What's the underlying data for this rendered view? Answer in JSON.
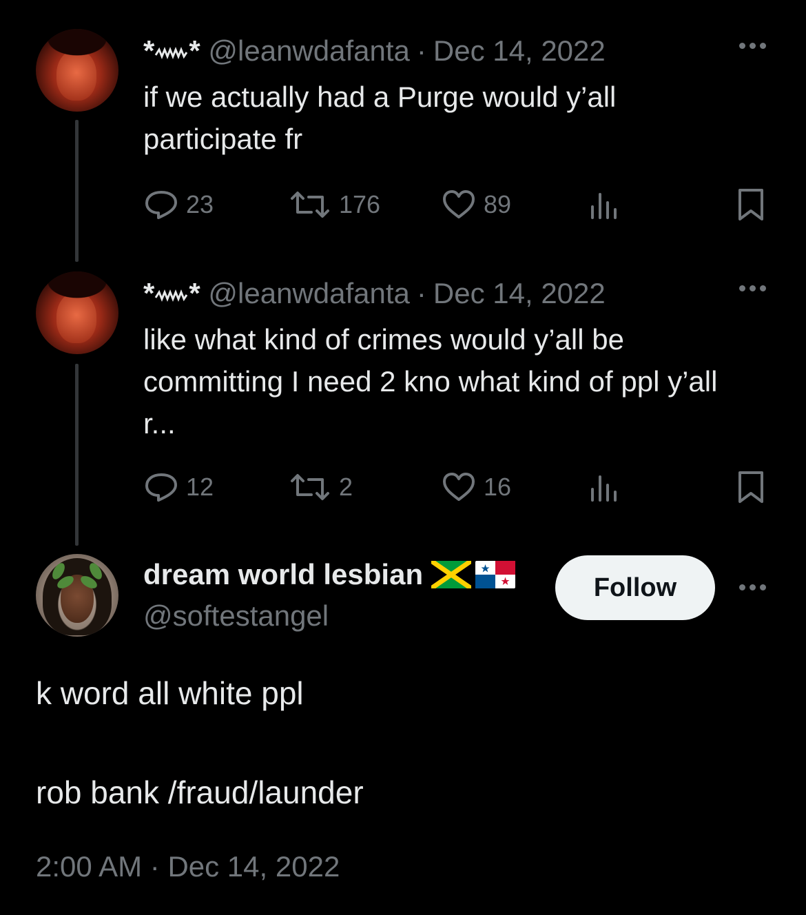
{
  "thread": [
    {
      "name": "*ஜஜ*",
      "handle": "@leanwdafanta",
      "separator": "·",
      "date": "Dec 14, 2022",
      "text": "if we actually had a Purge would y’all participate fr",
      "replies": "23",
      "retweets": "176",
      "likes": "89"
    },
    {
      "name": "*ஜஜ*",
      "handle": "@leanwdafanta",
      "separator": "·",
      "date": "Dec 14, 2022",
      "text": "like what kind of crimes would y’all be committing I need 2 kno what kind of ppl y’all r...",
      "replies": "12",
      "retweets": "2",
      "likes": "16"
    }
  ],
  "main_tweet": {
    "display_name": "dream world lesbian",
    "flags": [
      "jamaica-flag",
      "panama-flag"
    ],
    "handle": "@softestangel",
    "follow_label": "Follow",
    "lines": [
      "k word all white ppl",
      "rob bank /fraud/launder"
    ],
    "time": "2:00 AM",
    "separator": "·",
    "date": "Dec 14, 2022"
  },
  "colors": {
    "background": "#000000",
    "text": "#e7e9ea",
    "muted": "#71767b",
    "follow_bg": "#eff3f4"
  }
}
